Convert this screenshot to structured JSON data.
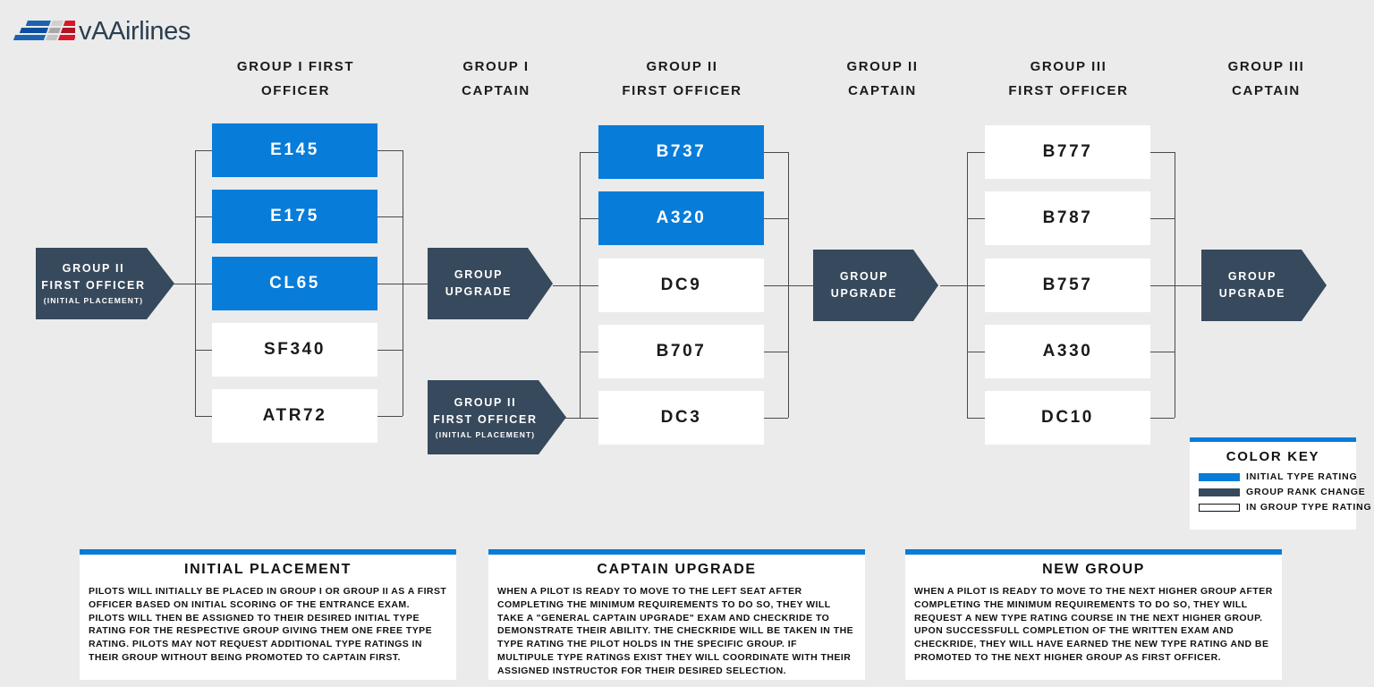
{
  "brand": {
    "name": "vAAirlines",
    "logo_colors": [
      "#1b63b0",
      "#0a4f9e",
      "#cfcfcf",
      "#9a9a9a",
      "#d8182a",
      "#a30f1e"
    ]
  },
  "colors": {
    "page_background": "#ebebeb",
    "initial_type_rating": "#077cd9",
    "group_rank_change": "#37495c",
    "in_group_type_rating": "#ffffff",
    "line": "#4a4a4a",
    "text": "#111111"
  },
  "columns": [
    {
      "line1": "GROUP I FIRST",
      "line2": "OFFICER"
    },
    {
      "line1": "GROUP I",
      "line2": "CAPTAIN"
    },
    {
      "line1": "GROUP II",
      "line2": "FIRST OFFICER"
    },
    {
      "line1": "GROUP II",
      "line2": "CAPTAIN"
    },
    {
      "line1": "GROUP III",
      "line2": "FIRST OFFICER"
    },
    {
      "line1": "GROUP III",
      "line2": "CAPTAIN"
    }
  ],
  "entry_nodes": [
    {
      "line1": "GROUP II",
      "line2": "FIRST OFFICER",
      "sub": "(INITIAL PLACEMENT)"
    },
    {
      "line1": "GROUP II",
      "line2": "FIRST OFFICER",
      "sub": "(INITIAL PLACEMENT)"
    }
  ],
  "upgrade_nodes": [
    {
      "line1": "GROUP",
      "line2": "UPGRADE"
    },
    {
      "line1": "GROUP",
      "line2": "UPGRADE"
    },
    {
      "line1": "GROUP",
      "line2": "UPGRADE"
    }
  ],
  "group1_aircraft": [
    {
      "name": "E145",
      "type": "initial"
    },
    {
      "name": "E175",
      "type": "initial"
    },
    {
      "name": "CL65",
      "type": "initial"
    },
    {
      "name": "SF340",
      "type": "in-group"
    },
    {
      "name": "ATR72",
      "type": "in-group"
    }
  ],
  "group2_aircraft": [
    {
      "name": "B737",
      "type": "initial"
    },
    {
      "name": "A320",
      "type": "initial"
    },
    {
      "name": "DC9",
      "type": "in-group"
    },
    {
      "name": "B707",
      "type": "in-group"
    },
    {
      "name": "DC3",
      "type": "in-group"
    }
  ],
  "group3_aircraft": [
    {
      "name": "B777",
      "type": "in-group"
    },
    {
      "name": "B787",
      "type": "in-group"
    },
    {
      "name": "B757",
      "type": "in-group"
    },
    {
      "name": "A330",
      "type": "in-group"
    },
    {
      "name": "DC10",
      "type": "in-group"
    }
  ],
  "color_key": {
    "title": "COLOR KEY",
    "items": [
      {
        "label": "INITIAL TYPE RATING",
        "swatch": "blue"
      },
      {
        "label": "GROUP RANK CHANGE",
        "swatch": "dark"
      },
      {
        "label": "IN GROUP TYPE RATING",
        "swatch": "outline"
      }
    ]
  },
  "panels": [
    {
      "title": "INITIAL PLACEMENT",
      "body": "PILOTS WILL INITIALLY BE PLACED IN GROUP I OR GROUP II AS A FIRST OFFICER BASED ON INITIAL SCORING OF THE ENTRANCE EXAM. PILOTS WILL THEN BE ASSIGNED TO THEIR DESIRED INITIAL TYPE RATING FOR THE RESPECTIVE GROUP GIVING THEM ONE FREE TYPE RATING. PILOTS MAY NOT REQUEST ADDITIONAL TYPE RATINGS IN THEIR GROUP WITHOUT BEING PROMOTED TO CAPTAIN FIRST."
    },
    {
      "title": "CAPTAIN UPGRADE",
      "body": "WHEN A PILOT IS READY TO MOVE TO THE LEFT SEAT AFTER COMPLETING THE MINIMUM REQUIREMENTS TO DO SO, THEY WILL TAKE A \"GENERAL CAPTAIN UPGRADE\" EXAM AND CHECKRIDE TO DEMONSTRATE THEIR ABILITY. THE CHECKRIDE WILL BE TAKEN IN THE TYPE RATING THE PILOT HOLDS IN THE SPECIFIC GROUP. IF MULTIPULE TYPE RATINGS EXIST THEY WILL COORDINATE WITH THEIR ASSIGNED INSTRUCTOR FOR THEIR DESIRED SELECTION."
    },
    {
      "title": "NEW GROUP",
      "body": "WHEN A PILOT IS READY TO MOVE TO THE NEXT HIGHER GROUP AFTER COMPLETING THE MINIMUM REQUIREMENTS TO DO SO, THEY WILL REQUEST A NEW TYPE RATING COURSE IN THE NEXT HIGHER GROUP. UPON SUCCESSFULL COMPLETION OF THE WRITTEN EXAM AND CHECKRIDE, THEY WILL HAVE EARNED THE NEW TYPE RATING AND BE PROMOTED TO THE NEXT HIGHER GROUP AS FIRST OFFICER."
    }
  ]
}
